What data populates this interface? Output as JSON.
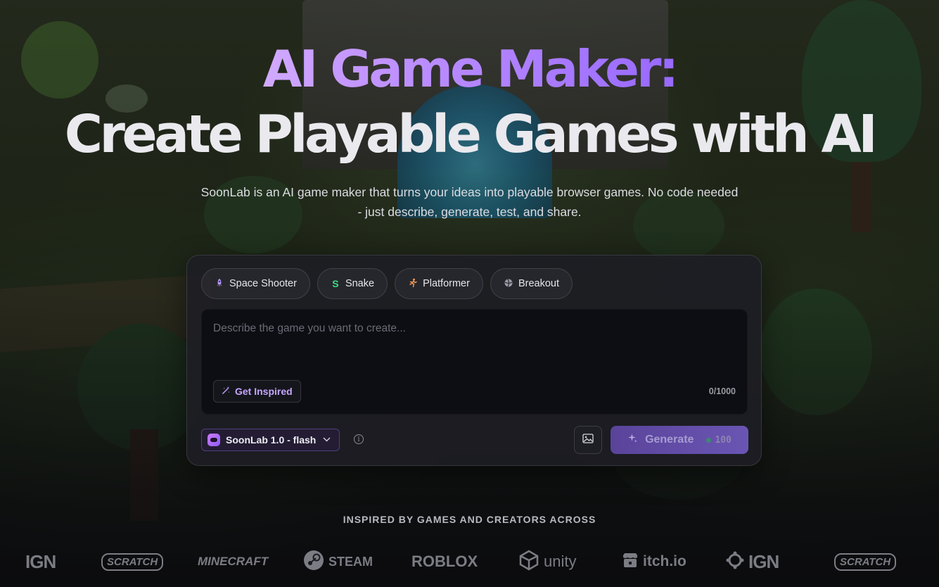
{
  "hero": {
    "title_line1": "AI Game Maker:",
    "title_line2": "Create Playable Games with AI",
    "subtitle": "SoonLab is an AI game maker that turns your ideas into playable browser games. No code needed - just describe, generate, test, and share."
  },
  "presets": [
    {
      "label": "Space Shooter",
      "icon": "rocket-icon"
    },
    {
      "label": "Snake",
      "icon": "snake-icon"
    },
    {
      "label": "Platformer",
      "icon": "running-figure-icon"
    },
    {
      "label": "Breakout",
      "icon": "ball-icon"
    }
  ],
  "prompt": {
    "placeholder": "Describe the game you want to create...",
    "value": "",
    "inspire_label": "Get Inspired",
    "char_count": "0/1000"
  },
  "controls": {
    "model_label": "SoonLab 1.0 - flash",
    "generate_label": "Generate",
    "generate_cost": "100"
  },
  "partners": {
    "heading": "INSPIRED BY GAMES AND CREATORS ACROSS",
    "logos": [
      "IGN",
      "SCRATCH",
      "MINECRAFT",
      "STEAM",
      "ROBLOX",
      "unity",
      "itch.io",
      "IGN",
      "SCRATCH"
    ]
  },
  "colors": {
    "accent": "#8b5cf6",
    "accent_light": "#c6a6ff",
    "panel_bg": "#1e1e24",
    "input_bg": "#0d0e13"
  }
}
